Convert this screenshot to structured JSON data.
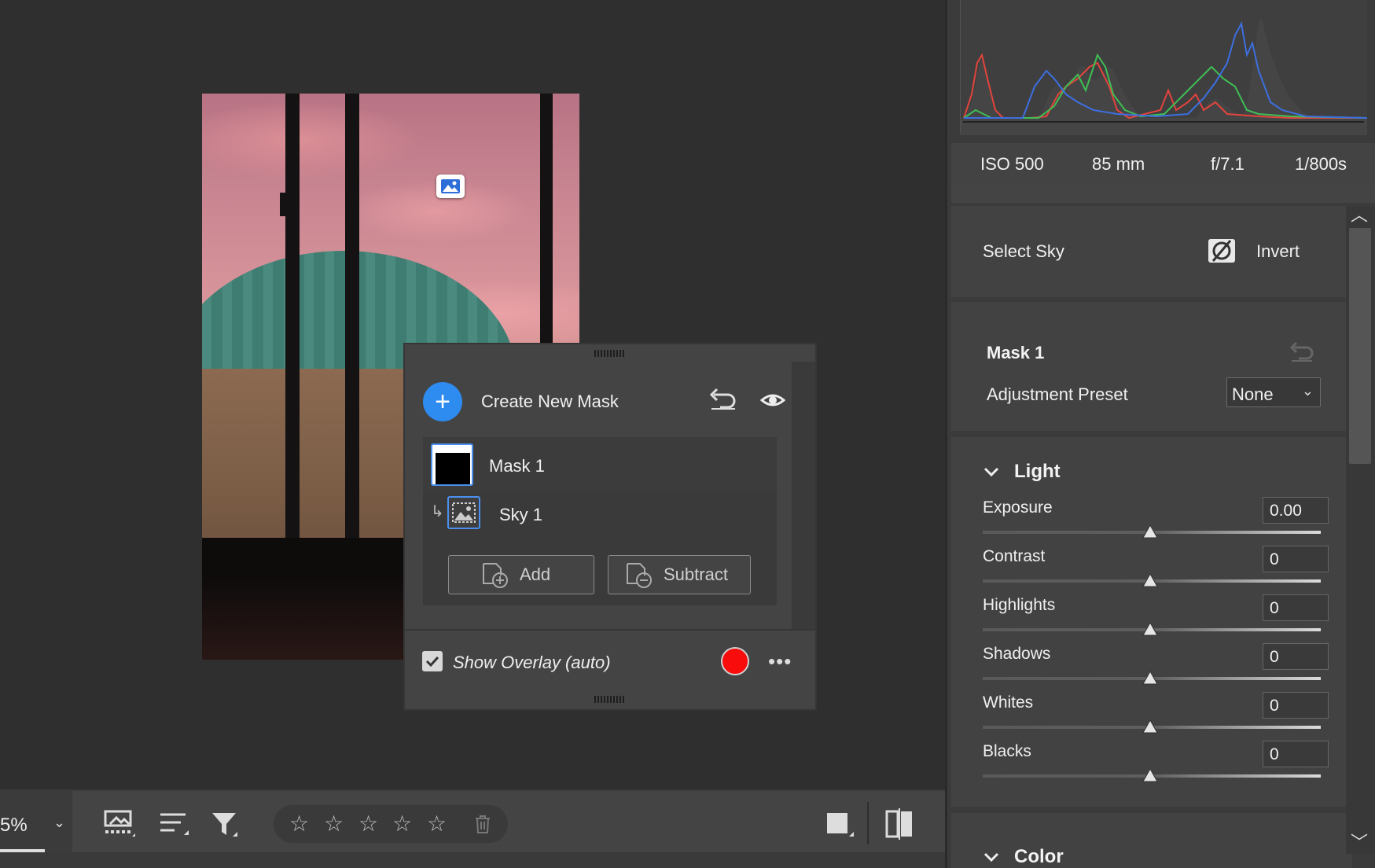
{
  "toolbar": {
    "zoom": "5%",
    "stars": [
      "☆",
      "☆",
      "☆",
      "☆",
      "☆"
    ]
  },
  "masks_panel": {
    "create_label": "Create New Mask",
    "mask_name": "Mask 1",
    "component_name": "Sky 1",
    "add_label": "Add",
    "subtract_label": "Subtract",
    "overlay_label": "Show Overlay (auto)",
    "overlay_checked": true,
    "overlay_color": "#f80c0c",
    "more": "•••"
  },
  "exif": {
    "iso": "ISO 500",
    "focal": "85 mm",
    "aperture": "f/7.1",
    "shutter": "1/800s"
  },
  "panel": {
    "select_sky": "Select Sky",
    "invert": "Invert",
    "mask_title": "Mask 1",
    "preset_label": "Adjustment Preset",
    "preset_value": "None",
    "light_title": "Light",
    "color_title": "Color",
    "adjustments": [
      {
        "label": "Exposure",
        "value": "0.00"
      },
      {
        "label": "Contrast",
        "value": "0"
      },
      {
        "label": "Highlights",
        "value": "0"
      },
      {
        "label": "Shadows",
        "value": "0"
      },
      {
        "label": "Whites",
        "value": "0"
      },
      {
        "label": "Blacks",
        "value": "0"
      }
    ]
  },
  "colors": {
    "accent": "#2e8bf0",
    "panel_bg": "#424242",
    "canvas_bg": "#2f2f2f"
  },
  "icons": [
    "image-pin-icon",
    "plus-icon",
    "undo-icon",
    "eye-icon",
    "add-mask-icon",
    "subtract-mask-icon",
    "checkbox-icon",
    "more-icon",
    "filmstrip-icon",
    "sort-icon",
    "filter-icon",
    "star-icon",
    "trash-icon",
    "crop-view-icon",
    "compare-icon",
    "invert-icon",
    "reset-icon",
    "chevron-down-icon",
    "chevron-up-icon"
  ]
}
